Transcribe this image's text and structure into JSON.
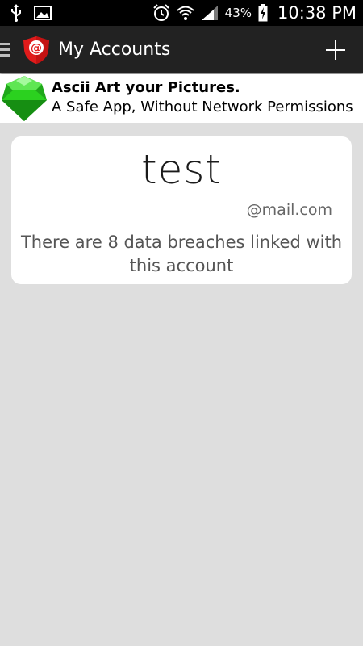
{
  "status_bar": {
    "battery_percent": "43%",
    "time": "10:38 PM"
  },
  "action_bar": {
    "title": "My Accounts"
  },
  "ad": {
    "title": "Ascii Art your Pictures.",
    "subtitle": "A Safe App, Without Network Permissions"
  },
  "account_card": {
    "name": "test",
    "domain": "@mail.com",
    "message": "There are 8 data breaches linked with this account"
  },
  "icons": {
    "status_left": [
      "usb-icon",
      "image-icon"
    ],
    "status_right": [
      "alarm-icon",
      "wifi-icon",
      "signal-icon",
      "battery-charging-icon"
    ],
    "app_logo": "shield-at-icon",
    "ad_icon": "green-gem-icon",
    "add": "plus-icon",
    "menu": "hamburger-icon"
  },
  "colors": {
    "action_bar": "#222222",
    "background": "#dedede",
    "logo_red": "#e01b1b",
    "gem_green": "#22c41a"
  }
}
